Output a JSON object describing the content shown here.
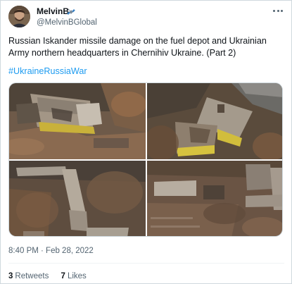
{
  "tweet": {
    "author": {
      "display_name": "MelvinB",
      "handle": "@MelvinBGlobal",
      "badge_icon": "satellite-icon"
    },
    "text": "Russian Iskander missile damage on the fuel depot and Ukrainian Army northern headquarters in Chernihiv Ukraine. (Part 2)",
    "hashtag": "#UkraineRussiaWar",
    "timestamp": "8:40 PM · Feb 28, 2022",
    "stats": {
      "retweets_count": "3",
      "retweets_label": "Retweets",
      "likes_count": "7",
      "likes_label": "Likes"
    }
  },
  "colors": {
    "text_primary": "#0f1419",
    "text_secondary": "#536471",
    "link": "#1d9bf0",
    "border": "#cfd9de"
  }
}
